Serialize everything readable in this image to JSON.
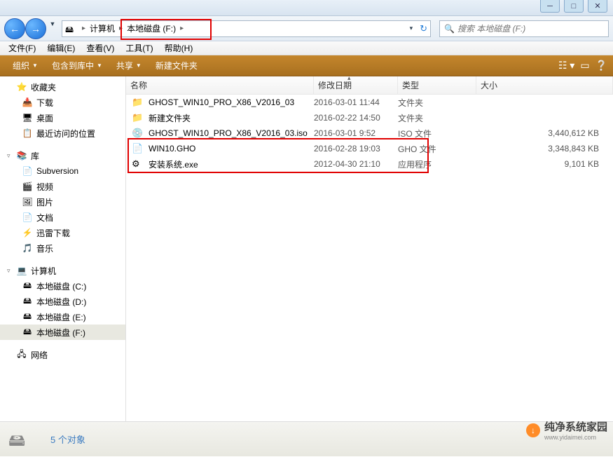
{
  "breadcrumb": {
    "part1": "计算机",
    "part2": "本地磁盘 (F:)"
  },
  "search": {
    "placeholder": "搜索 本地磁盘 (F:)"
  },
  "menu": {
    "file": "文件(F)",
    "edit": "编辑(E)",
    "view": "查看(V)",
    "tools": "工具(T)",
    "help": "帮助(H)"
  },
  "toolbar": {
    "organize": "组织",
    "include": "包含到库中",
    "share": "共享",
    "newfolder": "新建文件夹"
  },
  "columns": {
    "name": "名称",
    "date": "修改日期",
    "type": "类型",
    "size": "大小"
  },
  "sidebar": {
    "favorites": {
      "label": "收藏夹",
      "items": [
        "下载",
        "桌面",
        "最近访问的位置"
      ]
    },
    "libraries": {
      "label": "库",
      "items": [
        "Subversion",
        "视频",
        "图片",
        "文档",
        "迅雷下载",
        "音乐"
      ]
    },
    "computer": {
      "label": "计算机",
      "items": [
        "本地磁盘 (C:)",
        "本地磁盘 (D:)",
        "本地磁盘 (E:)",
        "本地磁盘 (F:)"
      ]
    },
    "network": {
      "label": "网络"
    }
  },
  "files": [
    {
      "name": "GHOST_WIN10_PRO_X86_V2016_03",
      "date": "2016-03-01 11:44",
      "type": "文件夹",
      "size": "",
      "icon": "folder"
    },
    {
      "name": "新建文件夹",
      "date": "2016-02-22 14:50",
      "type": "文件夹",
      "size": "",
      "icon": "folder"
    },
    {
      "name": "GHOST_WIN10_PRO_X86_V2016_03.iso",
      "date": "2016-03-01 9:52",
      "type": "ISO 文件",
      "size": "3,440,612 KB",
      "icon": "iso"
    },
    {
      "name": "WIN10.GHO",
      "date": "2016-02-28 19:03",
      "type": "GHO 文件",
      "size": "3,348,843 KB",
      "icon": "file"
    },
    {
      "name": "安装系统.exe",
      "date": "2012-04-30 21:10",
      "type": "应用程序",
      "size": "9,101 KB",
      "icon": "exe"
    }
  ],
  "status": {
    "count": "5 个对象"
  },
  "watermark": {
    "title": "纯净系统家园",
    "sub": "www.yidaimei.com"
  }
}
